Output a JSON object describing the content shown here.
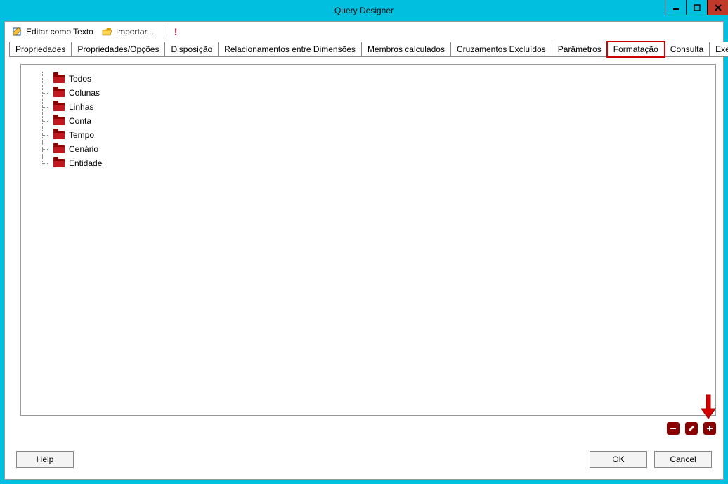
{
  "window": {
    "title": "Query Designer"
  },
  "toolbar": {
    "edit_text_label": "Editar como Texto",
    "import_label": "Importar..."
  },
  "tabs": [
    {
      "label": "Propriedades"
    },
    {
      "label": "Propriedades/Opções"
    },
    {
      "label": "Disposição"
    },
    {
      "label": "Relacionamentos entre Dimensões"
    },
    {
      "label": "Membros calculados"
    },
    {
      "label": "Cruzamentos Excluídos"
    },
    {
      "label": "Parâmetros"
    },
    {
      "label": "Formatação",
      "highlight": true
    },
    {
      "label": "Consulta"
    },
    {
      "label": "Execução"
    }
  ],
  "tree": {
    "items": [
      {
        "label": "Todos"
      },
      {
        "label": "Colunas"
      },
      {
        "label": "Linhas"
      },
      {
        "label": "Conta"
      },
      {
        "label": "Tempo"
      },
      {
        "label": "Cenário"
      },
      {
        "label": "Entidade"
      }
    ]
  },
  "action_buttons": {
    "remove": "−",
    "edit": "✎",
    "add": "+"
  },
  "footer": {
    "help": "Help",
    "ok": "OK",
    "cancel": "Cancel"
  }
}
